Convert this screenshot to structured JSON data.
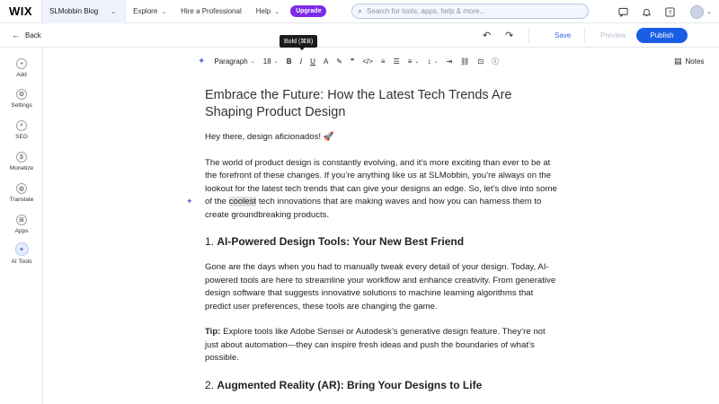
{
  "topbar": {
    "logo": "WIX",
    "site_name": "SLMobbin Blog",
    "nav": [
      "Explore",
      "Hire a Professional",
      "Help"
    ],
    "upgrade": "Upgrade",
    "search_placeholder": "Search for tools, apps, help & more..."
  },
  "secondbar": {
    "back": "Back",
    "save": "Save",
    "preview": "Preview",
    "publish": "Publish"
  },
  "sidebar": {
    "items": [
      {
        "label": "Add",
        "icon": "plus-icon"
      },
      {
        "label": "Settings",
        "icon": "gear-icon"
      },
      {
        "label": "SEO",
        "icon": "search-icon"
      },
      {
        "label": "Monetize",
        "icon": "dollar-icon"
      },
      {
        "label": "Translate",
        "icon": "globe-icon"
      },
      {
        "label": "Apps",
        "icon": "apps-icon"
      },
      {
        "label": "AI Tools",
        "icon": "sparkle-icon"
      }
    ]
  },
  "toolbar": {
    "paragraph": "Paragraph",
    "font_size": "18",
    "tooltip": "Bold (⌘B)",
    "notes": "Notes"
  },
  "article": {
    "title": "Embrace the Future: How the Latest Tech Trends Are Shaping Product Design",
    "greeting": "Hey there, design aficionados! 🚀",
    "intro_before": "The world of product design is constantly evolving, and it’s more exciting than ever to be at the forefront of these changes. If you’re anything like us at SLMobbin, you’re always on the lookout for the latest tech trends that can give your designs an edge. So, let’s dive into some of the ",
    "intro_highlight": "coolest",
    "intro_after": " tech innovations that are making waves and how you can harness them to create groundbreaking products.",
    "h2_1_num": "1. ",
    "h2_1_text": "AI-Powered Design Tools: Your New Best Friend",
    "p2": "Gone are the days when you had to manually tweak every detail of your design. Today, AI-powered tools are here to streamline your workflow and enhance creativity. From generative design software that suggests innovative solutions to machine learning algorithms that predict user preferences, these tools are changing the game.",
    "tip_label": "Tip:",
    "tip_text": " Explore tools like Adobe Sensei or Autodesk’s generative design feature. They’re not just about automation—they can inspire fresh ideas and push the boundaries of what’s possible.",
    "h2_2_num": "2. ",
    "h2_2_text": "Augmented Reality (AR): Bring Your Designs to Life"
  },
  "colors": {
    "accent": "#1b5ee6",
    "upgrade": "#7d2ae8",
    "ai": "#5d6fd6"
  }
}
